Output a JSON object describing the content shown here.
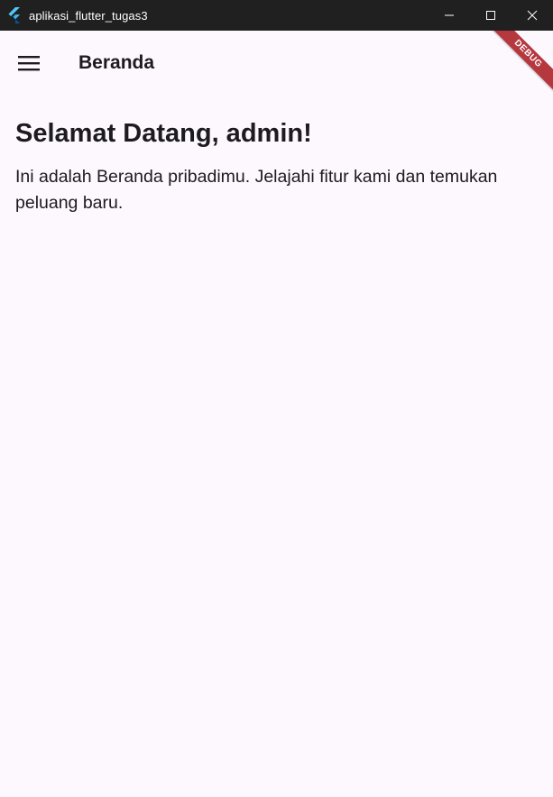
{
  "window": {
    "title": "aplikasi_flutter_tugas3",
    "app_icon": "flutter-logo-icon",
    "controls": [
      "minimize-icon",
      "maximize-icon",
      "close-icon"
    ]
  },
  "appbar": {
    "menu_icon": "hamburger-menu-icon",
    "title": "Beranda"
  },
  "debug_banner": {
    "label": "DEBUG",
    "color": "#b5383f"
  },
  "content": {
    "heading": "Selamat Datang, admin!",
    "body": "Ini adalah Beranda pribadimu. Jelajahi fitur kami dan temukan peluang baru."
  },
  "colors": {
    "titlebar": "#202020",
    "background": "#fdf7fe",
    "text": "#1d1b20"
  }
}
